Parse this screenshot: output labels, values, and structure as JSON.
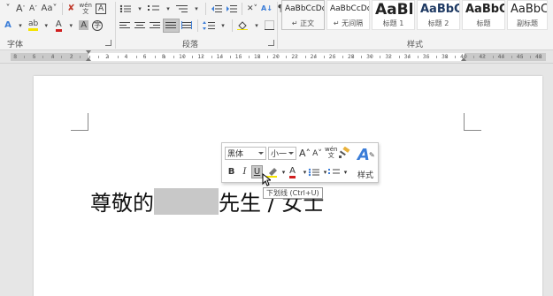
{
  "ribbon": {
    "groups": {
      "font": "字体",
      "paragraph": "段落",
      "styles": "样式"
    },
    "font_row1": [
      "A˅",
      "A˄",
      "Aa˅",
      "wén",
      "A"
    ],
    "font_row2": [
      "A",
      "ab",
      "A",
      "Aa",
      "A"
    ],
    "style_gallery": [
      {
        "sample": "AaBbCcDd",
        "name": "↵ 正文",
        "size": "9px",
        "weight": "normal"
      },
      {
        "sample": "AaBbCcDd",
        "name": "↵ 无间隔",
        "size": "9px",
        "weight": "normal"
      },
      {
        "sample": "AaBl",
        "name": "标题 1",
        "size": "17px",
        "weight": "bold"
      },
      {
        "sample": "AaBbC",
        "name": "标题 2",
        "size": "13px",
        "weight": "bold"
      },
      {
        "sample": "AaBbC",
        "name": "标题",
        "size": "13px",
        "weight": "bold"
      },
      {
        "sample": "AaBbC",
        "name": "副标题",
        "size": "13px",
        "weight": "normal"
      }
    ]
  },
  "ruler": {
    "left_numbers": [
      "8",
      "6",
      "4",
      "2"
    ],
    "right_numbers": [
      "2",
      "4",
      "6",
      "8",
      "10",
      "12",
      "14",
      "16",
      "18",
      "20",
      "22",
      "24",
      "26",
      "28",
      "30",
      "32",
      "34",
      "36",
      "38",
      "40",
      "42",
      "44",
      "46",
      "48"
    ]
  },
  "document": {
    "text_before": "尊敬的",
    "text_after": "先生 / 女士"
  },
  "mini_toolbar": {
    "font_name": "黑体",
    "font_size": "小一",
    "grow_font": "A˄",
    "shrink_font": "A˅",
    "bold": "B",
    "italic": "I",
    "underline": "U",
    "font_color": "A",
    "styles_label": "样式"
  },
  "tooltip": {
    "text": "下划线 (Ctrl+U)"
  }
}
